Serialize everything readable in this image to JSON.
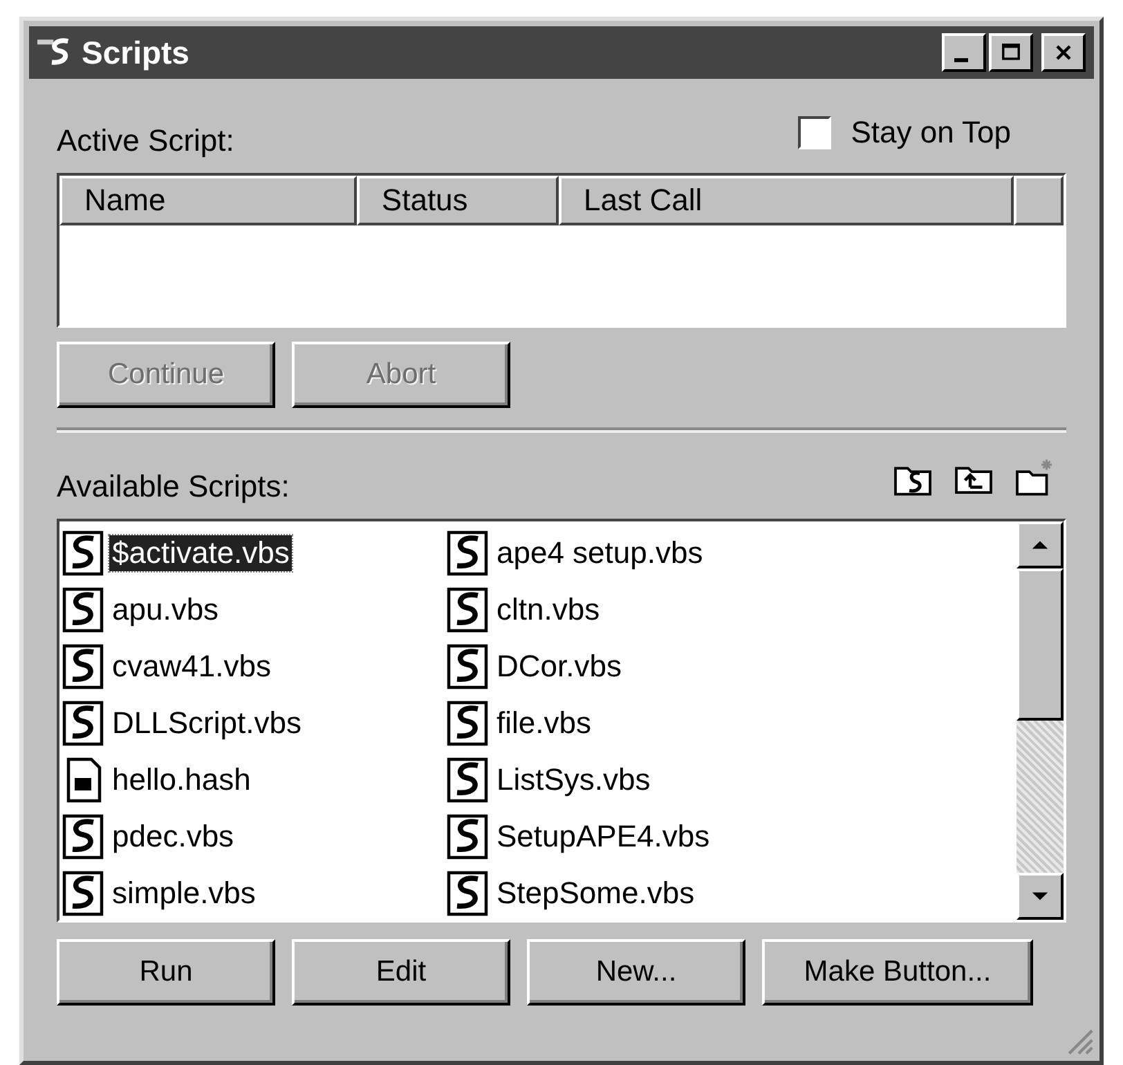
{
  "window": {
    "title": "Scripts"
  },
  "stay_on_top": {
    "label": "Stay on Top",
    "checked": false
  },
  "active_script": {
    "label": "Active Script:",
    "columns": [
      "Name",
      "Status",
      "Last Call"
    ]
  },
  "active_buttons": [
    {
      "label": "Continue",
      "disabled": true
    },
    {
      "label": "Abort",
      "disabled": true
    }
  ],
  "available_scripts": {
    "label": "Available Scripts:",
    "items": [
      {
        "name": "$activate.vbs",
        "kind": "script",
        "selected": true
      },
      {
        "name": "apu.vbs",
        "kind": "script",
        "selected": false
      },
      {
        "name": "cvaw41.vbs",
        "kind": "script",
        "selected": false
      },
      {
        "name": "DLLScript.vbs",
        "kind": "script",
        "selected": false
      },
      {
        "name": "hello.hash",
        "kind": "hash",
        "selected": false
      },
      {
        "name": "pdec.vbs",
        "kind": "script",
        "selected": false
      },
      {
        "name": "simple.vbs",
        "kind": "script",
        "selected": false
      },
      {
        "name": "ape4 setup.vbs",
        "kind": "script",
        "selected": false
      },
      {
        "name": "cltn.vbs",
        "kind": "script",
        "selected": false
      },
      {
        "name": "DCor.vbs",
        "kind": "script",
        "selected": false
      },
      {
        "name": "file.vbs",
        "kind": "script",
        "selected": false
      },
      {
        "name": "ListSys.vbs",
        "kind": "script",
        "selected": false
      },
      {
        "name": "SetupAPE4.vbs",
        "kind": "script",
        "selected": false
      },
      {
        "name": "StepSome.vbs",
        "kind": "script",
        "selected": false
      }
    ]
  },
  "buttons": [
    {
      "label": "Run",
      "disabled": false
    },
    {
      "label": "Edit",
      "disabled": false
    },
    {
      "label": "New...",
      "disabled": false
    },
    {
      "label": "Make Button...",
      "disabled": false
    }
  ]
}
